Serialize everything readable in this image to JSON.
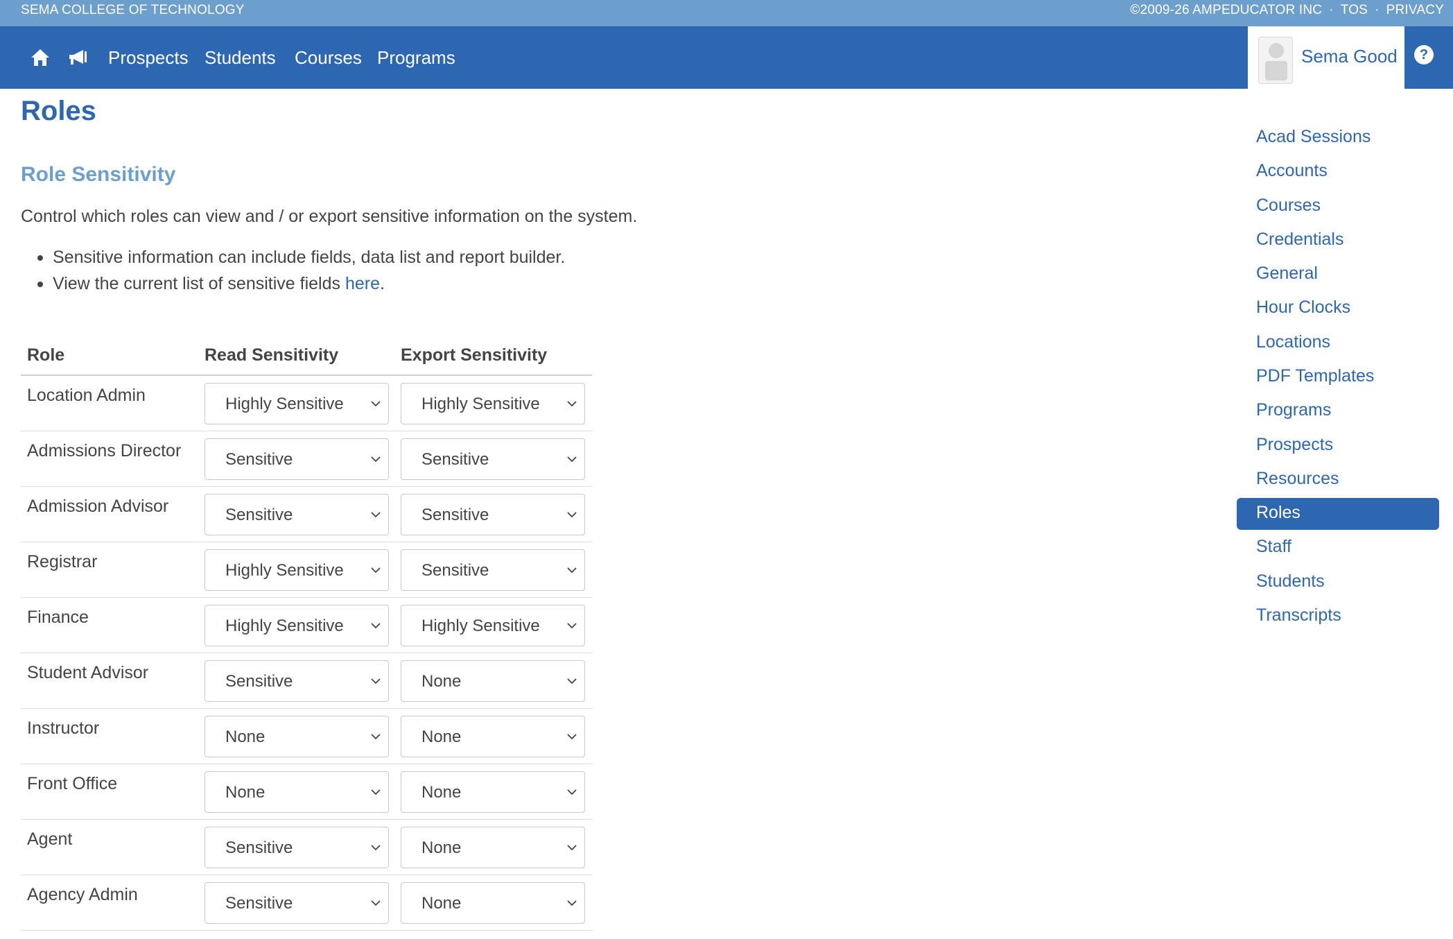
{
  "topbar": {
    "org": "SEMA COLLEGE OF TECHNOLOGY",
    "copyright": "©2009-26 AMPEDUCATOR INC",
    "tos": "TOS",
    "privacy": "PRIVACY",
    "separator": "·",
    "background": "#6d9fcd"
  },
  "nav": {
    "background": "#2e67b1",
    "icons": [
      "home-icon",
      "megaphone-icon"
    ],
    "links": [
      "Prospects",
      "Students",
      "Courses",
      "Programs"
    ],
    "user_name": "Sema Good",
    "help_label": "?"
  },
  "page": {
    "title": "Roles",
    "section_title": "Role Sensitivity",
    "description": "Control which roles can view and / or export sensitive information on the system.",
    "bullet_1": "Sensitive information can include fields, data list and report builder.",
    "bullet_2_prefix": "View the current list of sensitive fields ",
    "bullet_2_link": "here",
    "bullet_2_suffix": "."
  },
  "table": {
    "headers": [
      "Role",
      "Read Sensitivity",
      "Export Sensitivity"
    ],
    "rows": [
      {
        "role": "Location Admin",
        "read": "Highly Sensitive",
        "export": "Highly Sensitive"
      },
      {
        "role": "Admissions Director",
        "read": "Sensitive",
        "export": "Sensitive"
      },
      {
        "role": "Admission Advisor",
        "read": "Sensitive",
        "export": "Sensitive"
      },
      {
        "role": "Registrar",
        "read": "Highly Sensitive",
        "export": "Sensitive"
      },
      {
        "role": "Finance",
        "read": "Highly Sensitive",
        "export": "Highly Sensitive"
      },
      {
        "role": "Student Advisor",
        "read": "Sensitive",
        "export": "None"
      },
      {
        "role": "Instructor",
        "read": "None",
        "export": "None"
      },
      {
        "role": "Front Office",
        "read": "None",
        "export": "None"
      },
      {
        "role": "Agent",
        "read": "Sensitive",
        "export": "None"
      },
      {
        "role": "Agency Admin",
        "read": "Sensitive",
        "export": "None"
      }
    ]
  },
  "sidebar": {
    "items": [
      "Acad Sessions",
      "Accounts",
      "Courses",
      "Credentials",
      "General",
      "Hour Clocks",
      "Locations",
      "PDF Templates",
      "Programs",
      "Prospects",
      "Resources",
      "Roles",
      "Staff",
      "Students",
      "Transcripts"
    ],
    "active": "Roles"
  }
}
